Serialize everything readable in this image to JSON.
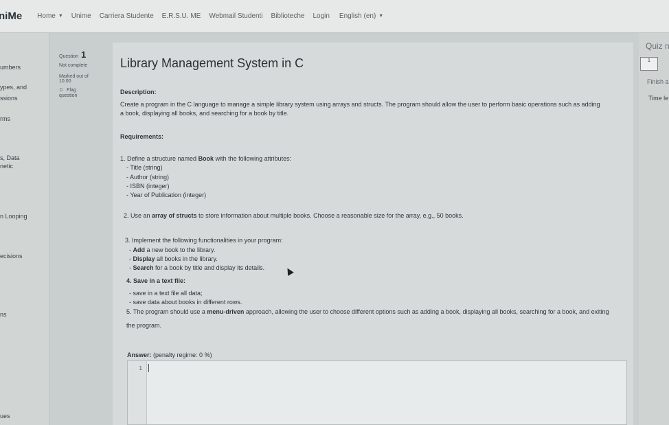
{
  "navbar": {
    "brand": "niMe",
    "items": [
      {
        "label": "Home",
        "caret": "▼"
      },
      {
        "label": "Unime"
      },
      {
        "label": "Carriera Studente"
      },
      {
        "label": "E.R.S.U. ME"
      },
      {
        "label": "Webmail Studenti"
      },
      {
        "label": "Biblioteche"
      },
      {
        "label": "Login"
      },
      {
        "label": "English (en)",
        "caret": "▼"
      }
    ]
  },
  "sidebar": {
    "items": [
      "umbers",
      "ypes, and",
      "ssions",
      "rms",
      "s, Data",
      "netic",
      "n Looping",
      "ecisions",
      "ns",
      "ues"
    ]
  },
  "question_info": {
    "label": "Question",
    "number": "1",
    "status": "Not complete",
    "marked_label": "Marked out of",
    "marked_value": "10.00",
    "flag_label": "Flag",
    "flag_suffix": "question"
  },
  "question": {
    "title": "Library Management System in C",
    "description_heading": "Description:",
    "description_line1": "Create a program in the C language to manage a simple library system using arrays and structs. The program should allow the user to perform basic operations such as adding",
    "description_line2": "a book, displaying all books, and searching for a book by title.",
    "requirements_heading": "Requirements:",
    "req1_prefix": "1. Define a structure named ",
    "req1_bold": "Book",
    "req1_suffix": " with the following attributes:",
    "attr1": "- Title (string)",
    "attr2": "- Author (string)",
    "attr3": "- ISBN (integer)",
    "attr4": "- Year of Publication (integer)",
    "req2_prefix": "2. Use an ",
    "req2_bold": "array of structs",
    "req2_suffix": " to store information about multiple books. Choose a reasonable size for the array, e.g., 50 books.",
    "req3": "3. Implement the following functionalities in your program:",
    "f1_dash": "- ",
    "f1_bold": "Add",
    "f1_rest": " a new book to the library.",
    "f2_dash": "- ",
    "f2_bold": "Display",
    "f2_rest": " all books in the library.",
    "f3_dash": "- ",
    "f3_bold": "Search",
    "f3_rest": " for a book by title and display its details.",
    "req4": "4. Save in a text file:",
    "s1": "- save in a text file all data;",
    "s2": "- save data about books in different rows.",
    "req5_prefix": "5. The program should use a ",
    "req5_bold": "menu-driven",
    "req5_suffix": " approach, allowing the user to choose different options such as adding a book, displaying all books, searching for a book, and exiting",
    "req5_line2": "the program."
  },
  "answer": {
    "label": "Answer:",
    "penalty": "(penalty regime: 0 %)",
    "line_number": "1"
  },
  "quiz_nav": {
    "title": "Quiz n",
    "button": "1",
    "finish": "Finish a",
    "time_left": "Time le"
  }
}
